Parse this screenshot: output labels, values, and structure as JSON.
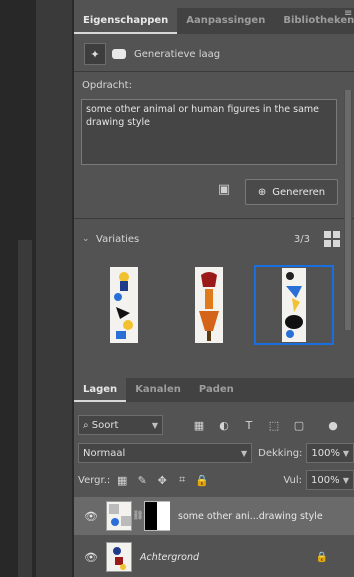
{
  "tabs": [
    "Eigenschappen",
    "Aanpassingen",
    "Bibliotheken"
  ],
  "generative": {
    "label": "Generatieve laag"
  },
  "prompt": {
    "label": "Opdracht:",
    "value": "some other animal or human figures in the same drawing style"
  },
  "generate_button": "Genereren",
  "variations": {
    "label": "Variaties",
    "count": "3/3"
  },
  "layers_tabs": [
    "Lagen",
    "Kanalen",
    "Paden"
  ],
  "filter": {
    "value": "Soort"
  },
  "blend_mode": {
    "value": "Normaal"
  },
  "opacity": {
    "label": "Dekking:",
    "value": "100%"
  },
  "lock_label": "Vergr.:",
  "fill": {
    "label": "Vul:",
    "value": "100%"
  },
  "layers": [
    {
      "name": "some other ani...drawing style",
      "selected": true
    },
    {
      "name": "Achtergrond",
      "selected": false
    }
  ],
  "colors": {
    "accent": "#1a6fe0",
    "panel": "#535353",
    "dark": "#282828"
  }
}
